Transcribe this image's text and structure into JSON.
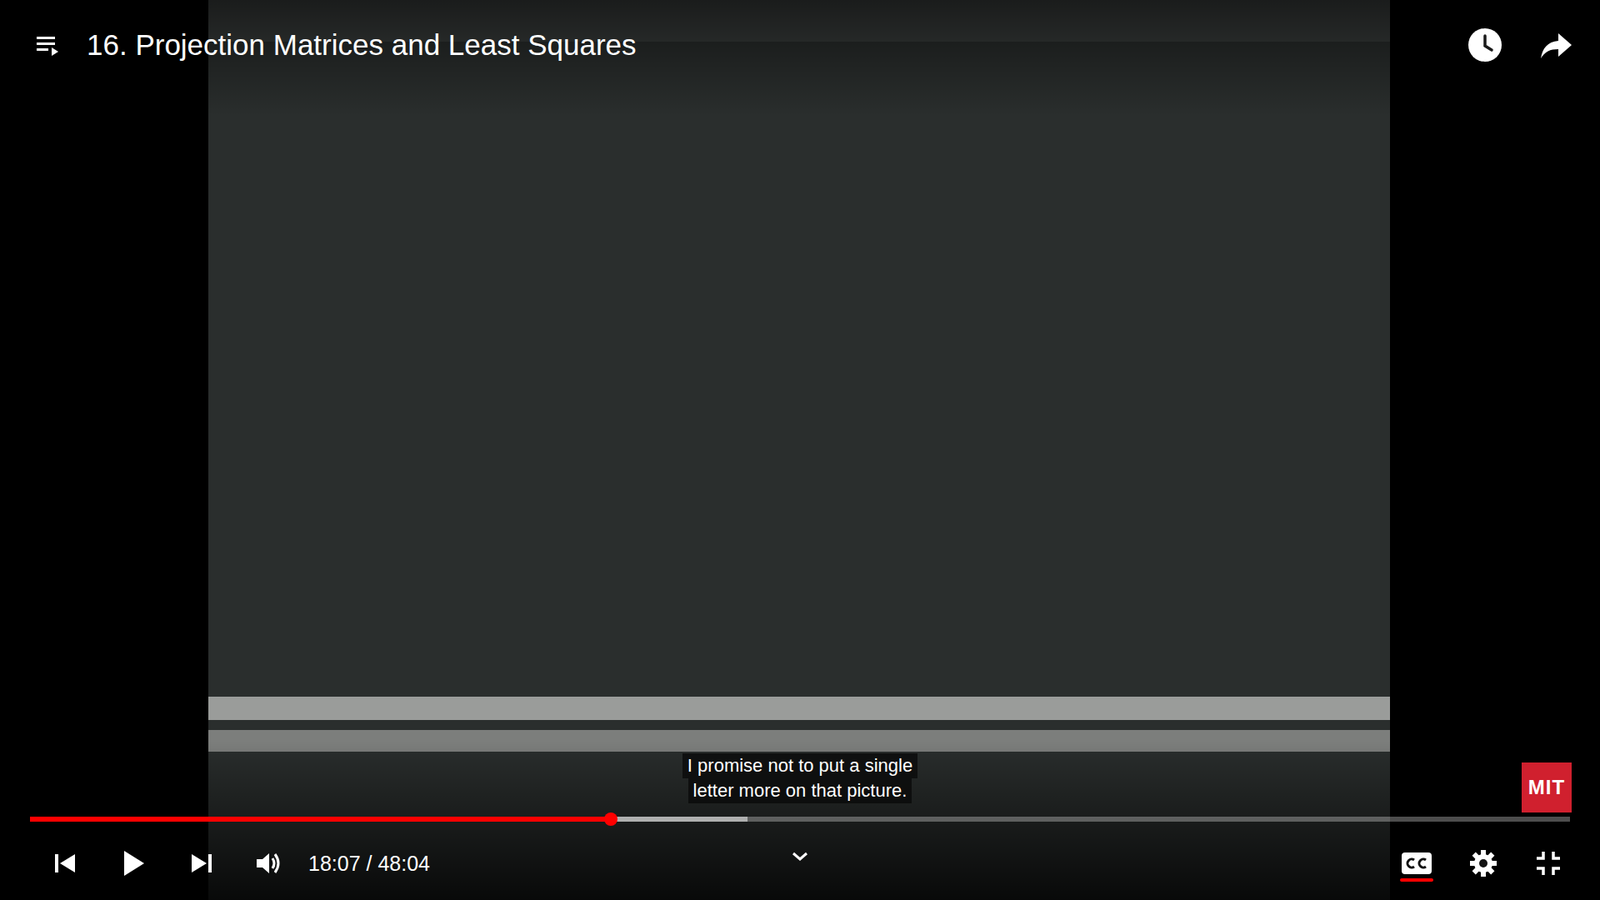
{
  "video": {
    "title": "16. Projection Matrices and Least Squares"
  },
  "caption": {
    "visible": true,
    "lines": [
      "I promise not to put a single",
      "letter more on that picture."
    ]
  },
  "watermark": {
    "label": "MIT"
  },
  "progress": {
    "played": 0.377,
    "buffered": 0.466
  },
  "time": {
    "display": "18:07 / 48:04"
  },
  "controls": {
    "playing": false,
    "captions_on": true
  }
}
